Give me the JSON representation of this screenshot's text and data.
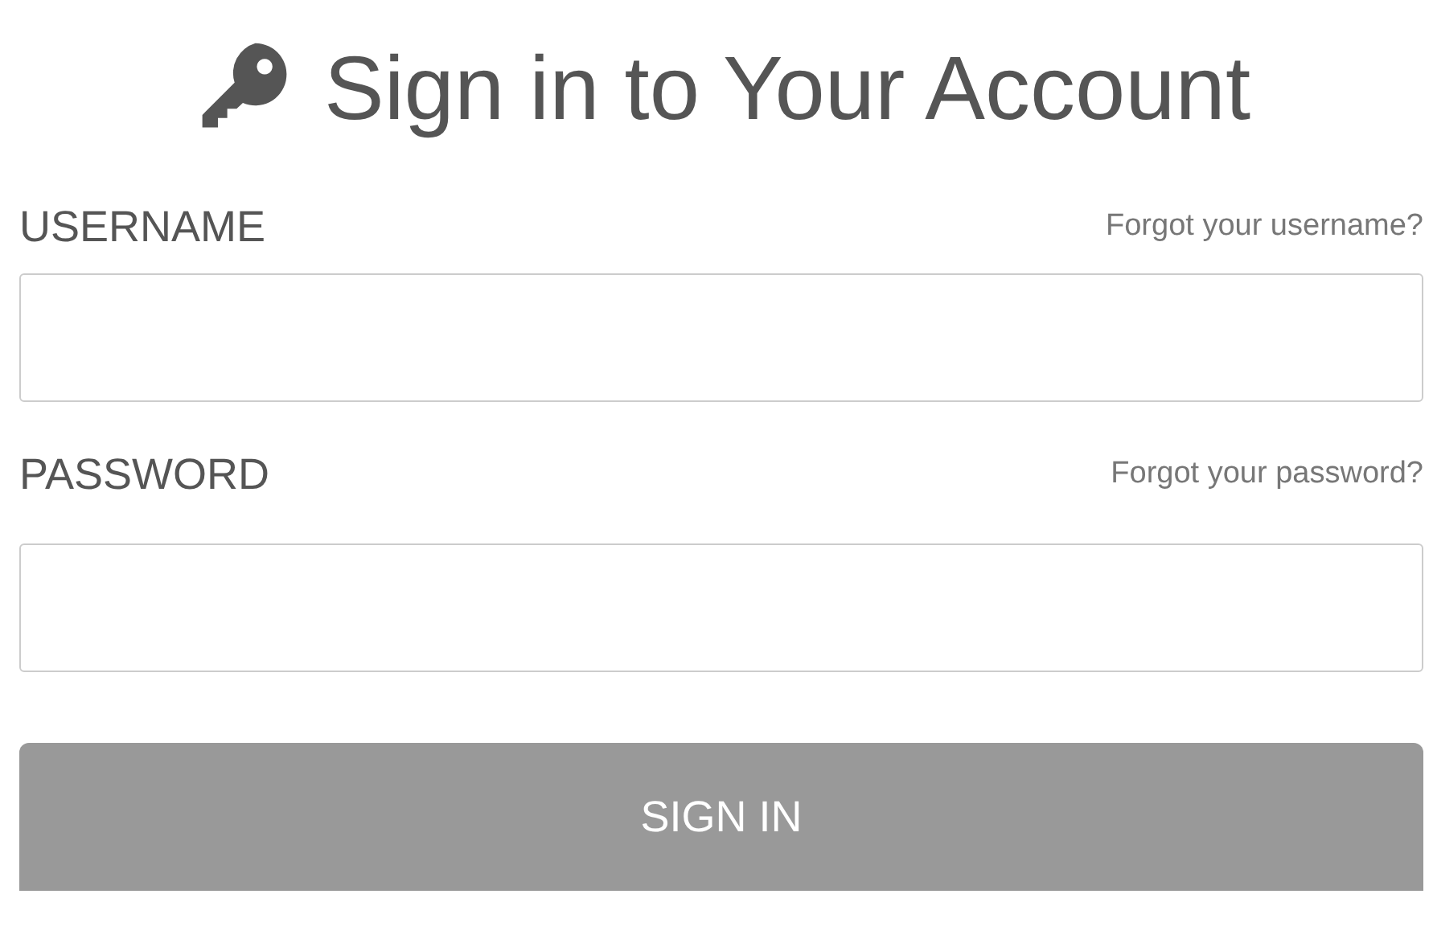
{
  "title": "Sign in to Your Account",
  "fields": [
    {
      "label": "USERNAME",
      "link": "Forgot your username?"
    },
    {
      "label": "PASSWORD",
      "link": "Forgot your password?"
    }
  ],
  "button": "SIGN IN"
}
